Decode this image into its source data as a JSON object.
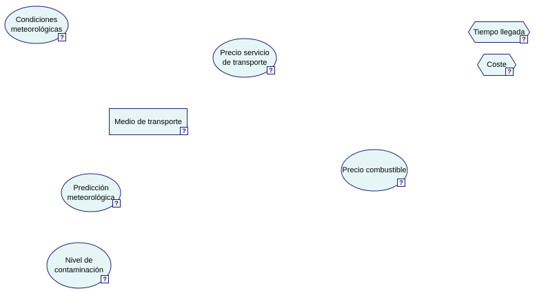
{
  "theme": {
    "fill": "#e6f6f6",
    "stroke": "#1f1f7a"
  },
  "nodes": {
    "condiciones": {
      "label": "Condiciones\nmeteorológicas",
      "shape": "ellipse",
      "badge": "?"
    },
    "precio_servicio": {
      "label": "Precio servicio\nde transporte",
      "shape": "ellipse",
      "badge": "?"
    },
    "tiempo_llegada": {
      "label": "Tiempo llegada",
      "shape": "hexagon",
      "badge": "?"
    },
    "coste": {
      "label": "Coste",
      "shape": "hexagon",
      "badge": "?"
    },
    "medio_transporte": {
      "label": "Medio de transporte",
      "shape": "rectangle",
      "badge": "?"
    },
    "precio_combustible": {
      "label": "Precio combustible",
      "shape": "ellipse",
      "badge": "?"
    },
    "prediccion": {
      "label": "Predicción\nmeteorológica",
      "shape": "ellipse",
      "badge": "?"
    },
    "contaminacion": {
      "label": "Nivel de\ncontaminación",
      "shape": "ellipse",
      "badge": "?"
    }
  }
}
